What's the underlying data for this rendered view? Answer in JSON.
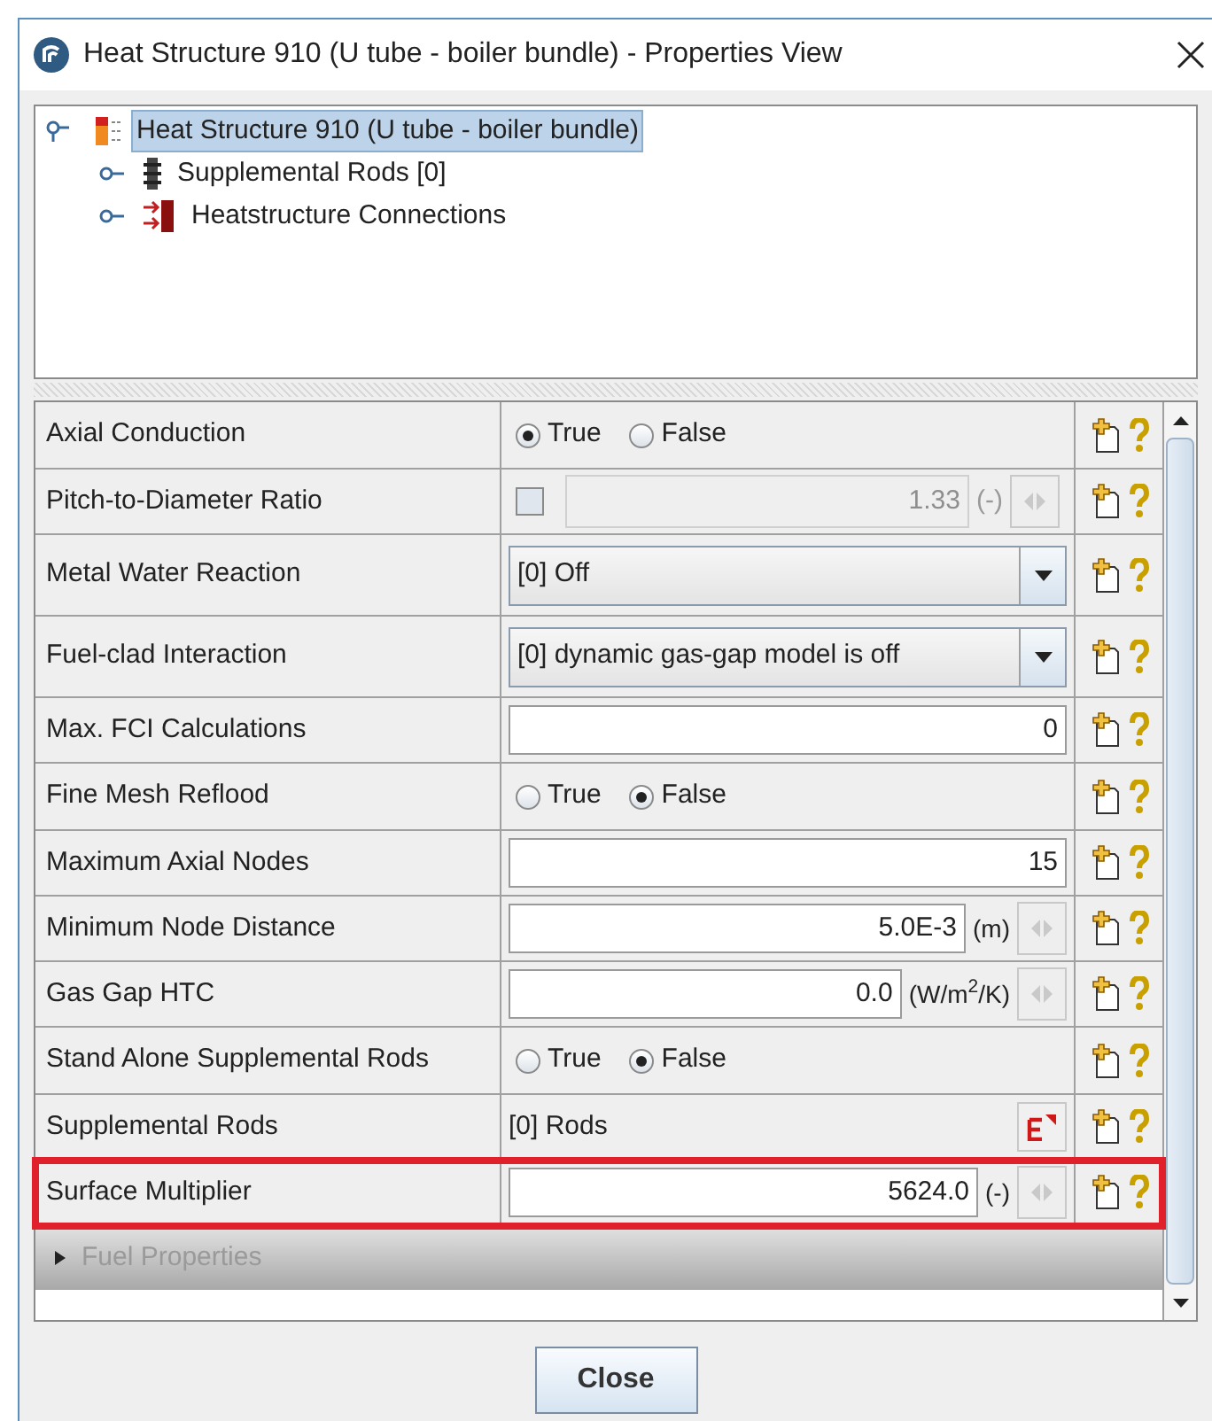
{
  "window": {
    "title": "Heat Structure 910 (U tube - boiler bundle) - Properties View"
  },
  "tree": {
    "label": "Heat Structure 910 (U tube - boiler bundle)",
    "selected": true,
    "expanded": true,
    "children": [
      {
        "label": "Supplemental Rods [0]",
        "kind": "rods",
        "selected": false,
        "expanded": false
      },
      {
        "label": "Heatstructure Connections",
        "kind": "connections",
        "selected": false,
        "expanded": false
      }
    ]
  },
  "properties": [
    {
      "kind": "radio",
      "label": "Axial Conduction",
      "options": [
        {
          "label": "True",
          "selected": true
        },
        {
          "label": "False",
          "selected": false
        }
      ]
    },
    {
      "kind": "checkbox_number",
      "label": "Pitch-to-Diameter Ratio",
      "checked": false,
      "value": "1.33",
      "unit": "(-)"
    },
    {
      "kind": "dropdown",
      "label": "Metal Water Reaction",
      "value": "[0] Off"
    },
    {
      "kind": "dropdown",
      "label": "Fuel-clad Interaction",
      "value": "[0] dynamic gas-gap model is off"
    },
    {
      "kind": "number",
      "label": "Max. FCI Calculations",
      "value": "0"
    },
    {
      "kind": "radio",
      "label": "Fine Mesh Reflood",
      "options": [
        {
          "label": "True",
          "selected": false
        },
        {
          "label": "False",
          "selected": true
        }
      ]
    },
    {
      "kind": "number",
      "label": "Maximum Axial Nodes",
      "value": "15"
    },
    {
      "kind": "number_unit",
      "label": "Minimum Node Distance",
      "value": "5.0E-3",
      "unit": "(m)",
      "highlighted": false
    },
    {
      "kind": "number_unit",
      "label": "Gas Gap HTC",
      "value": "0.0",
      "unit": "(W/m$^{2}$/K)",
      "highlighted": false
    },
    {
      "kind": "radio",
      "label": "Stand Alone Supplemental Rods",
      "options": [
        {
          "label": "True",
          "selected": false
        },
        {
          "label": "False",
          "selected": true
        }
      ]
    },
    {
      "kind": "rods",
      "label": "Supplemental Rods",
      "value": "[0] Rods"
    },
    {
      "kind": "number_unit",
      "label": "Surface Multiplier",
      "value": "5624.0",
      "unit": "(-)",
      "highlighted": true
    }
  ],
  "section": {
    "label": "Fuel Properties",
    "expanded": false
  },
  "buttons": [
    {
      "label": "Close"
    }
  ]
}
